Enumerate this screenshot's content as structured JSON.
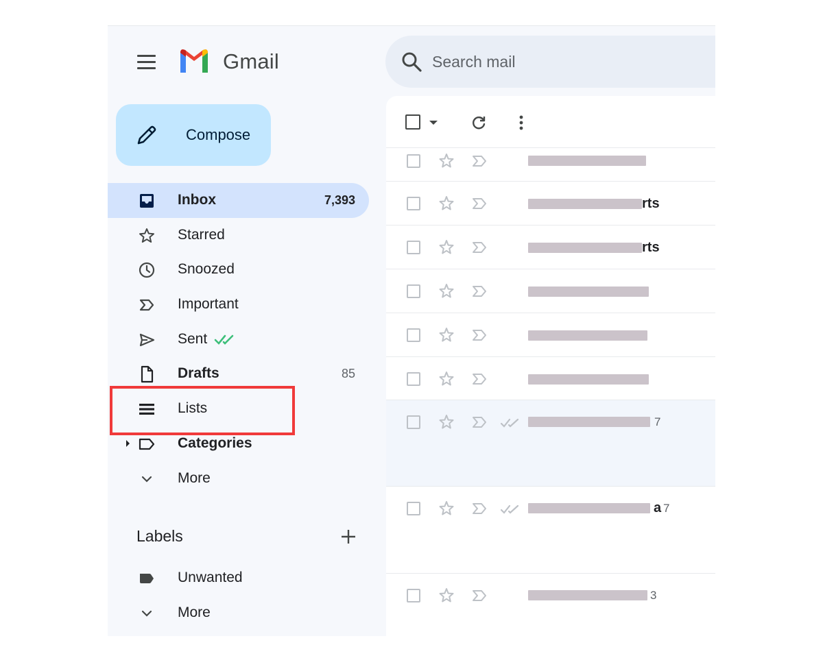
{
  "header": {
    "app_name": "Gmail",
    "search_placeholder": "Search mail"
  },
  "compose": {
    "label": "Compose"
  },
  "nav": [
    {
      "label": "Inbox",
      "count": "7,393",
      "icon": "inbox-icon",
      "active": true
    },
    {
      "label": "Starred",
      "icon": "star-icon"
    },
    {
      "label": "Snoozed",
      "icon": "clock-icon"
    },
    {
      "label": "Important",
      "icon": "important-icon"
    },
    {
      "label": "Sent",
      "icon": "send-icon"
    },
    {
      "label": "Drafts",
      "count": "85",
      "icon": "draft-icon"
    },
    {
      "label": "Lists",
      "icon": "lists-icon",
      "highlighted": true
    },
    {
      "label": "Categories",
      "icon": "label-icon"
    },
    {
      "label": "More",
      "icon": "chevron-down-icon"
    }
  ],
  "labels": {
    "title": "Labels",
    "items": [
      {
        "label": "Unwanted",
        "icon": "label-filled-icon"
      },
      {
        "label": "More",
        "icon": "chevron-down-icon"
      }
    ]
  },
  "mail_rows": [
    {
      "sender_visible": "",
      "count": ""
    },
    {
      "sender_visible": "rts",
      "count": ""
    },
    {
      "sender_visible": "rts",
      "count": ""
    },
    {
      "sender_visible": "",
      "count": ""
    },
    {
      "sender_visible": "",
      "count": ""
    },
    {
      "sender_visible": "",
      "count": ""
    },
    {
      "sender_visible": "",
      "count": "7"
    },
    {
      "sender_visible": "a",
      "count": "7"
    },
    {
      "sender_visible": "",
      "count": "3"
    }
  ],
  "colors": {
    "accent_compose": "#c2e7ff",
    "active_nav": "#d3e3fd",
    "sidebar_bg": "#f6f8fc",
    "highlight_border": "#f03a3a",
    "sent_check": "#3dbf7a"
  }
}
